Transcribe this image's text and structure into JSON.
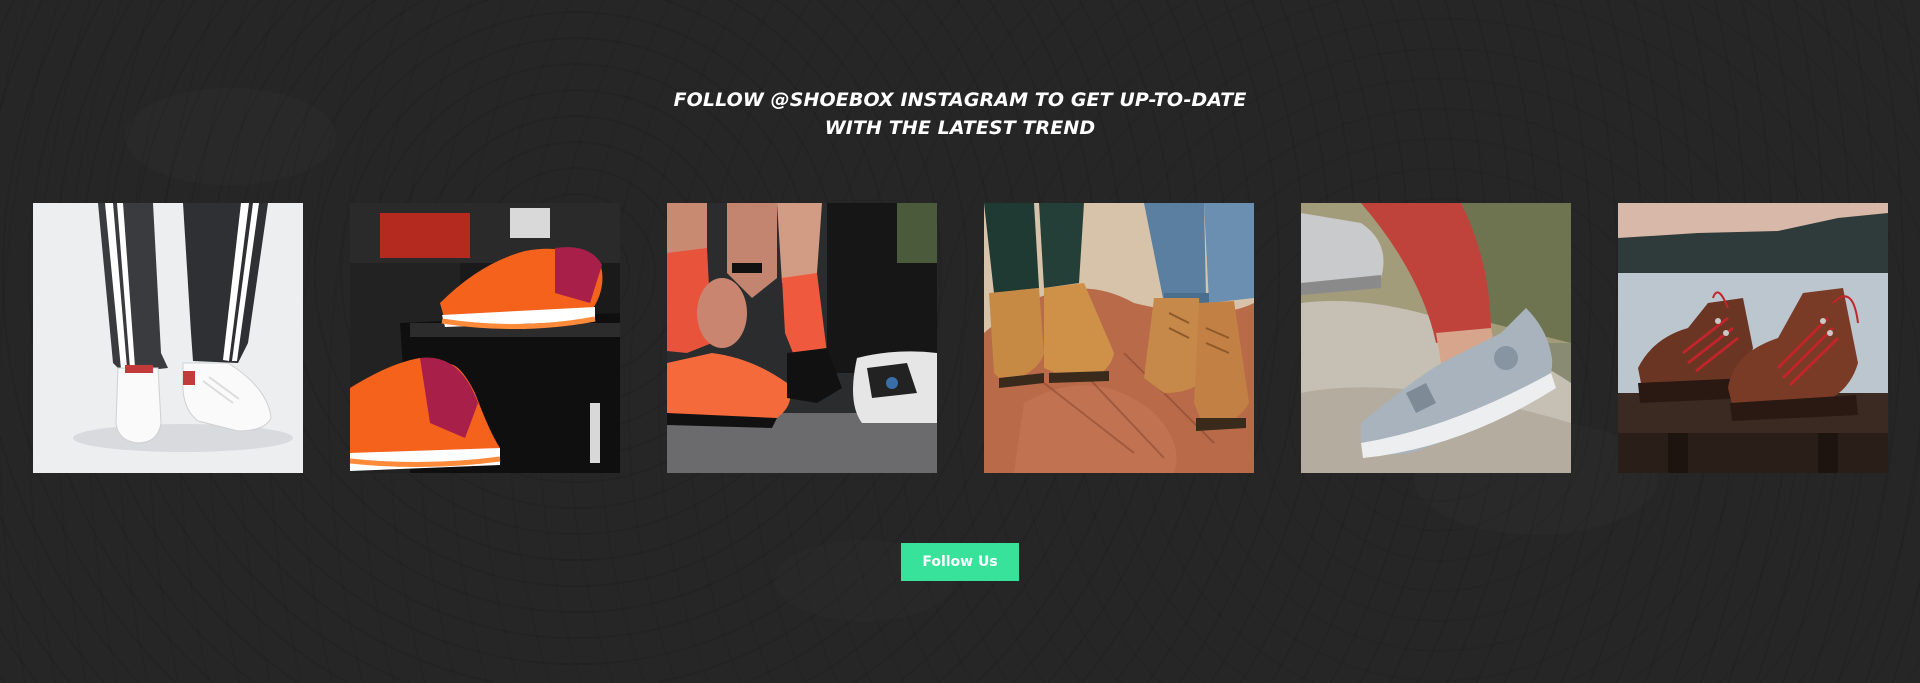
{
  "heading": {
    "line1": "FOLLOW @SHOEBOX INSTAGRAM TO GET UP-TO-DATE",
    "line2": "WITH THE LATEST TREND"
  },
  "gallery": {
    "items": [
      {
        "icon": "white-sneakers-track-pants-photo"
      },
      {
        "icon": "orange-running-shoes-display-photo"
      },
      {
        "icon": "cycling-shoes-red-socks-photo"
      },
      {
        "icon": "tan-leather-boots-on-rock-photo"
      },
      {
        "icon": "grey-hiking-shoe-photo"
      },
      {
        "icon": "brown-hiking-boots-lake-photo"
      }
    ]
  },
  "cta": {
    "follow_label": "Follow Us",
    "color": "#38e29a"
  },
  "colors": {
    "background": "#262626",
    "text": "#ffffff"
  }
}
